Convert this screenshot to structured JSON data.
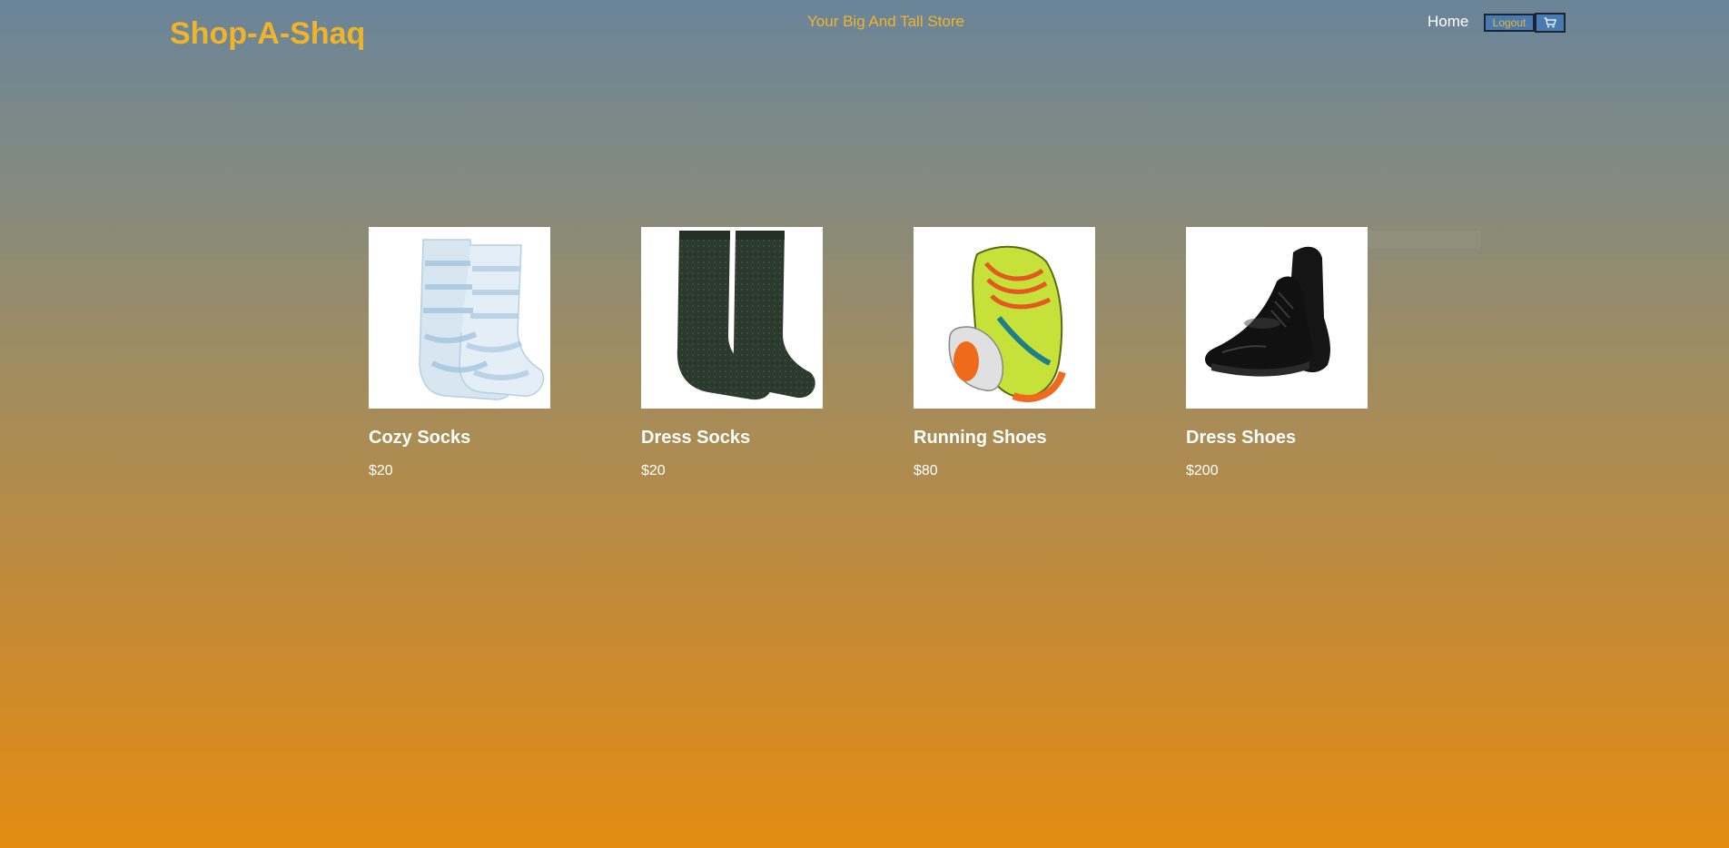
{
  "header": {
    "logo": "Shop-A-Shaq",
    "tagline": "Your Big And Tall Store",
    "nav_home": "Home",
    "logout_label": "Logout",
    "cart_icon": "cart-icon"
  },
  "products": [
    {
      "name": "Cozy Socks",
      "price": "$20",
      "image": "cozy-socks-image"
    },
    {
      "name": "Dress Socks",
      "price": "$20",
      "image": "dress-socks-image"
    },
    {
      "name": "Running Shoes",
      "price": "$80",
      "image": "running-shoes-image"
    },
    {
      "name": "Dress Shoes",
      "price": "$200",
      "image": "dress-shoes-image"
    }
  ],
  "colors": {
    "brand": "#f0b42a",
    "button": "#4a7bb0",
    "gradient_top": "#6a8499",
    "gradient_bottom": "#e38c12"
  }
}
